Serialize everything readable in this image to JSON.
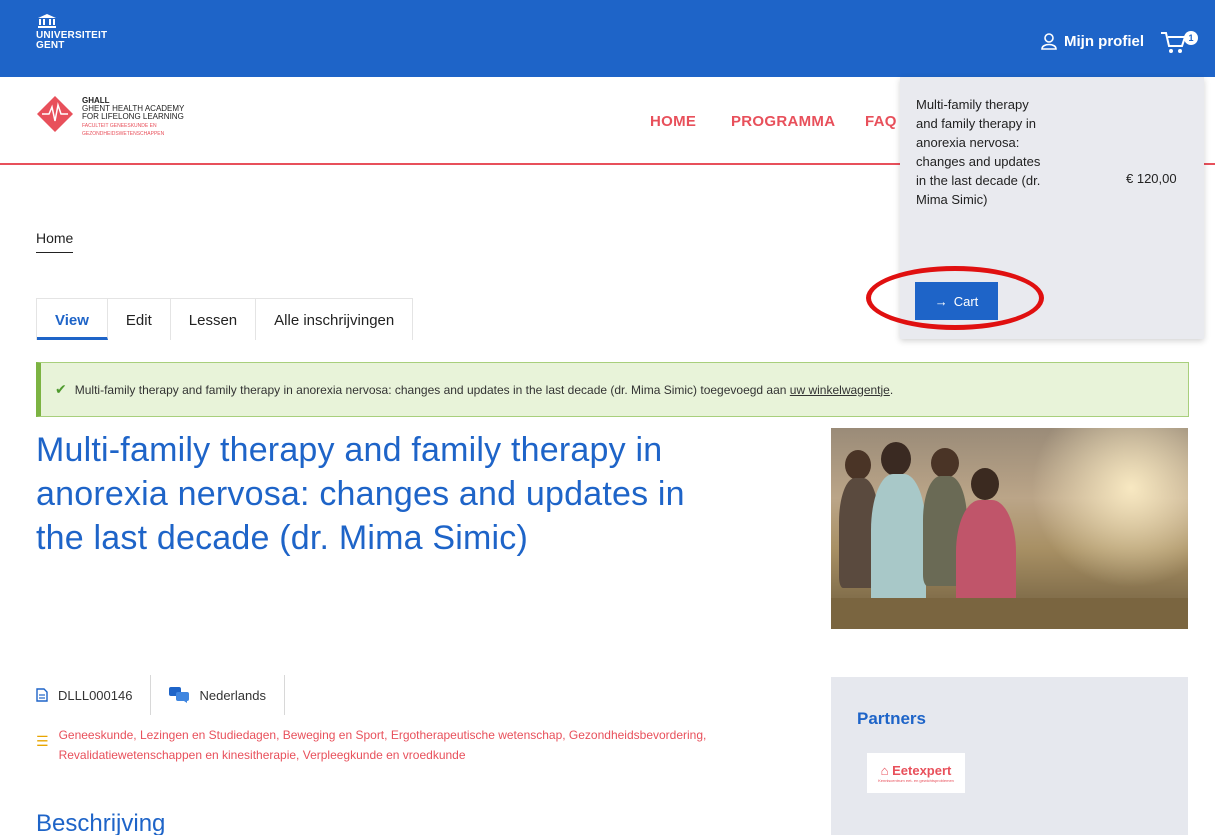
{
  "topbar": {
    "logo_line1": "UNIVERSITEIT",
    "logo_line2": "GENT",
    "profile_label": "Mijn profiel",
    "cart_count": "1"
  },
  "siteheader": {
    "logo_line1": "GHALL",
    "logo_line2": "GHENT HEALTH ACADEMY",
    "logo_line3": "FOR LIFELONG LEARNING",
    "logo_sub1": "FACULTEIT GENEESKUNDE EN",
    "logo_sub2": "GEZONDHEIDSWETENSCHAPPEN",
    "nav": [
      "HOME",
      "PROGRAMMA",
      "FAQ"
    ]
  },
  "breadcrumb": "Home",
  "tabs": [
    "View",
    "Edit",
    "Lessen",
    "Alle inschrijvingen"
  ],
  "status": {
    "message": "Multi-family therapy and family therapy in anorexia nervosa: changes and updates in the last decade (dr. Mima Simic) toegevoegd aan ",
    "link": "uw winkelwagentje",
    "suffix": "."
  },
  "page_title": "Multi-family therapy and family therapy in anorexia nervosa: changes and updates in the last decade (dr. Mima Simic)",
  "meta": {
    "code": "DLLL000146",
    "language": "Nederlands",
    "tags": "Geneeskunde, Lezingen en Studiedagen, Beweging en Sport, Ergotherapeutische wetenschap, Gezondheidsbevordering, Revalidatiewetenschappen en kinesitherapie, Verpleegkunde en vroedkunde"
  },
  "section_heading": "Beschrijving",
  "partners": {
    "heading": "Partners",
    "logo_name": "Eetexpert",
    "logo_sub": "Kenniscentrum eet- en gewichtsproblemen"
  },
  "cart_popup": {
    "item_title": "Multi-family therapy and family therapy in anorexia nervosa: changes and updates in the last decade (dr. Mima Simic)",
    "price": "€ 120,00",
    "button_label": "Cart",
    "button_arrow": "→"
  },
  "colors": {
    "brand_blue": "#1e64c8",
    "accent_red": "#e8505b",
    "success_bg": "#e8f3d9",
    "annotation_red": "#e01010"
  }
}
